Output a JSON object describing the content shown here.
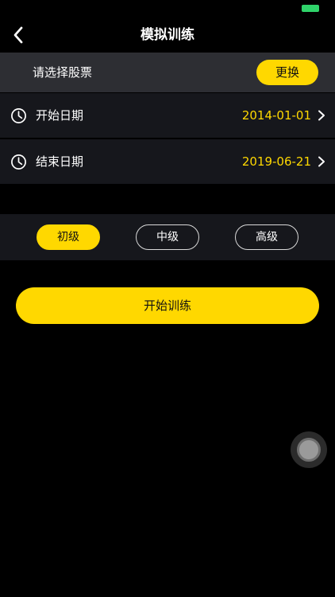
{
  "colors": {
    "accent": "#ffd800",
    "background": "#000000",
    "row_background": "#16171c",
    "stock_row_background": "#2d2e33",
    "battery": "#2fd36a"
  },
  "nav": {
    "title": "模拟训练",
    "back_icon": "chevron-left-icon"
  },
  "stock": {
    "label": "请选择股票",
    "change_label": "更换"
  },
  "dates": {
    "start": {
      "label": "开始日期",
      "value": "2014-01-01",
      "icon": "clock-icon"
    },
    "end": {
      "label": "结束日期",
      "value": "2019-06-21",
      "icon": "clock-icon"
    }
  },
  "levels": {
    "items": [
      {
        "label": "初级",
        "selected": true
      },
      {
        "label": "中级",
        "selected": false
      },
      {
        "label": "高级",
        "selected": false
      }
    ]
  },
  "start_training": {
    "label": "开始训练"
  }
}
